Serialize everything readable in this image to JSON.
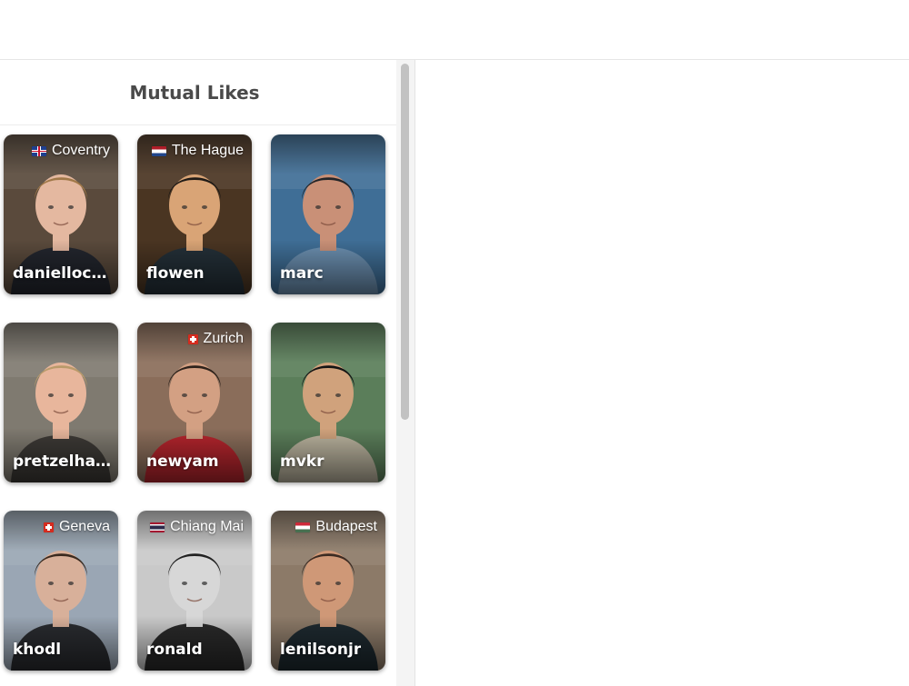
{
  "panel": {
    "title": "Mutual Likes"
  },
  "matches": [
    {
      "username": "daniellock...",
      "location": "Coventry",
      "flag": "uk-flag-icon",
      "colors": {
        "bg": "#5a4a3c",
        "skin": "#e4b8a0",
        "hair": "#a07848",
        "shirt": "#23262e"
      }
    },
    {
      "username": "flowen",
      "location": "The Hague",
      "flag": "netherlands-flag-icon",
      "colors": {
        "bg": "#4a3522",
        "skin": "#d9a476",
        "hair": "#1f1a16",
        "shirt": "#243038"
      }
    },
    {
      "username": "marc",
      "location": "",
      "flag": "",
      "colors": {
        "bg": "#3f6e96",
        "skin": "#c99077",
        "hair": "#222428",
        "shirt": "#6b8fb0"
      }
    },
    {
      "username": "pretzelhan...",
      "location": "",
      "flag": "",
      "colors": {
        "bg": "#7f7a70",
        "skin": "#e8b69c",
        "hair": "#b99a6a",
        "shirt": "#3d3a36"
      }
    },
    {
      "username": "newyam",
      "location": "Zurich",
      "flag": "switzerland-flag-icon",
      "colors": {
        "bg": "#8a6d5a",
        "skin": "#d3a083",
        "hair": "#2d221b",
        "shirt": "#b5252d"
      }
    },
    {
      "username": "mvkr",
      "location": "",
      "flag": "",
      "colors": {
        "bg": "#5b7e5a",
        "skin": "#d0a27c",
        "hair": "#141414",
        "shirt": "#bab39e"
      }
    },
    {
      "username": "khodl",
      "location": "Geneva",
      "flag": "switzerland-flag-icon",
      "colors": {
        "bg": "#9aa6b4",
        "skin": "#d8b09a",
        "hair": "#3a2a1f",
        "shirt": "#2a2c30"
      }
    },
    {
      "username": "ronald",
      "location": "Chiang Mai",
      "flag": "thailand-flag-icon",
      "colors": {
        "bg": "#c9c9c9",
        "skin": "#d7d7d7",
        "hair": "#222222",
        "shirt": "#2a2a2a"
      }
    },
    {
      "username": "lenilsonjr",
      "location": "Budapest",
      "flag": "hungary-flag-icon",
      "colors": {
        "bg": "#8c7a68",
        "skin": "#cf9877",
        "hair": "#3c2b22",
        "shirt": "#1e2a30"
      }
    }
  ]
}
